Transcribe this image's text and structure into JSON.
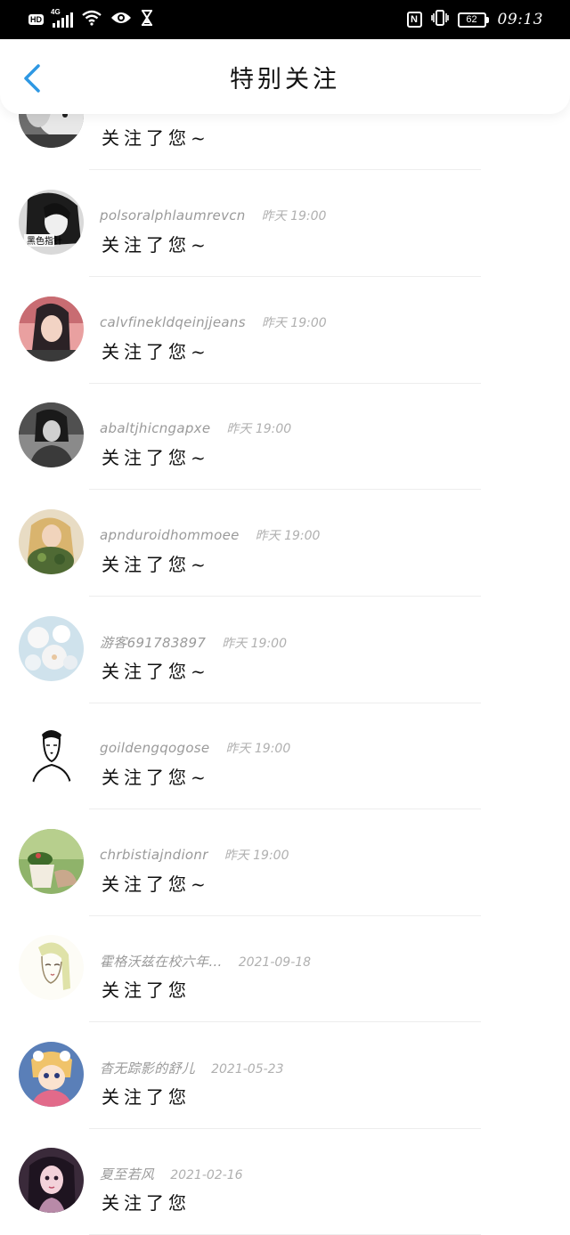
{
  "status_bar": {
    "hd": "HD",
    "network": "4G",
    "battery": "62",
    "time": "09:13"
  },
  "header": {
    "title": "特别关注",
    "back_icon": "chevron-left-icon"
  },
  "colors": {
    "accent": "#2e98e3",
    "status_bar_bg": "#000000",
    "meta_text": "#9a9a9a"
  },
  "items": [
    {
      "name": "",
      "time": "",
      "message": "关注了您~",
      "avatar": "dog-photo"
    },
    {
      "name": "polsoralphlaumrevcn",
      "time": "昨天 19:00",
      "message": "关注了您~",
      "avatar": "boy-bw-photo"
    },
    {
      "name": "calvfinekldqeinjjeans",
      "time": "昨天 19:00",
      "message": "关注了您~",
      "avatar": "girl-pink-photo"
    },
    {
      "name": "abaltjhicngapxe",
      "time": "昨天 19:00",
      "message": "关注了您~",
      "avatar": "girl-bw-photo"
    },
    {
      "name": "apnduroidhommoee",
      "time": "昨天 19:00",
      "message": "关注了您~",
      "avatar": "blonde-flowers-photo"
    },
    {
      "name": "游客691783897",
      "time": "昨天 19:00",
      "message": "关注了您~",
      "avatar": "white-blossom-photo"
    },
    {
      "name": "goildengqogose",
      "time": "昨天 19:00",
      "message": "关注了您~",
      "avatar": "man-sketch"
    },
    {
      "name": "chrbistiajndionr",
      "time": "昨天 19:00",
      "message": "关注了您~",
      "avatar": "cup-plant-photo"
    },
    {
      "name": "霍格沃兹在校六年…",
      "time": "2021-09-18",
      "message": "关注了您",
      "avatar": "anime-girl-sketch"
    },
    {
      "name": "杳无踪影的舒儿",
      "time": "2021-05-23",
      "message": "关注了您",
      "avatar": "anime-blue-avatar"
    },
    {
      "name": "夏至若风",
      "time": "2021-02-16",
      "message": "关注了您",
      "avatar": "anime-dark-avatar"
    }
  ]
}
